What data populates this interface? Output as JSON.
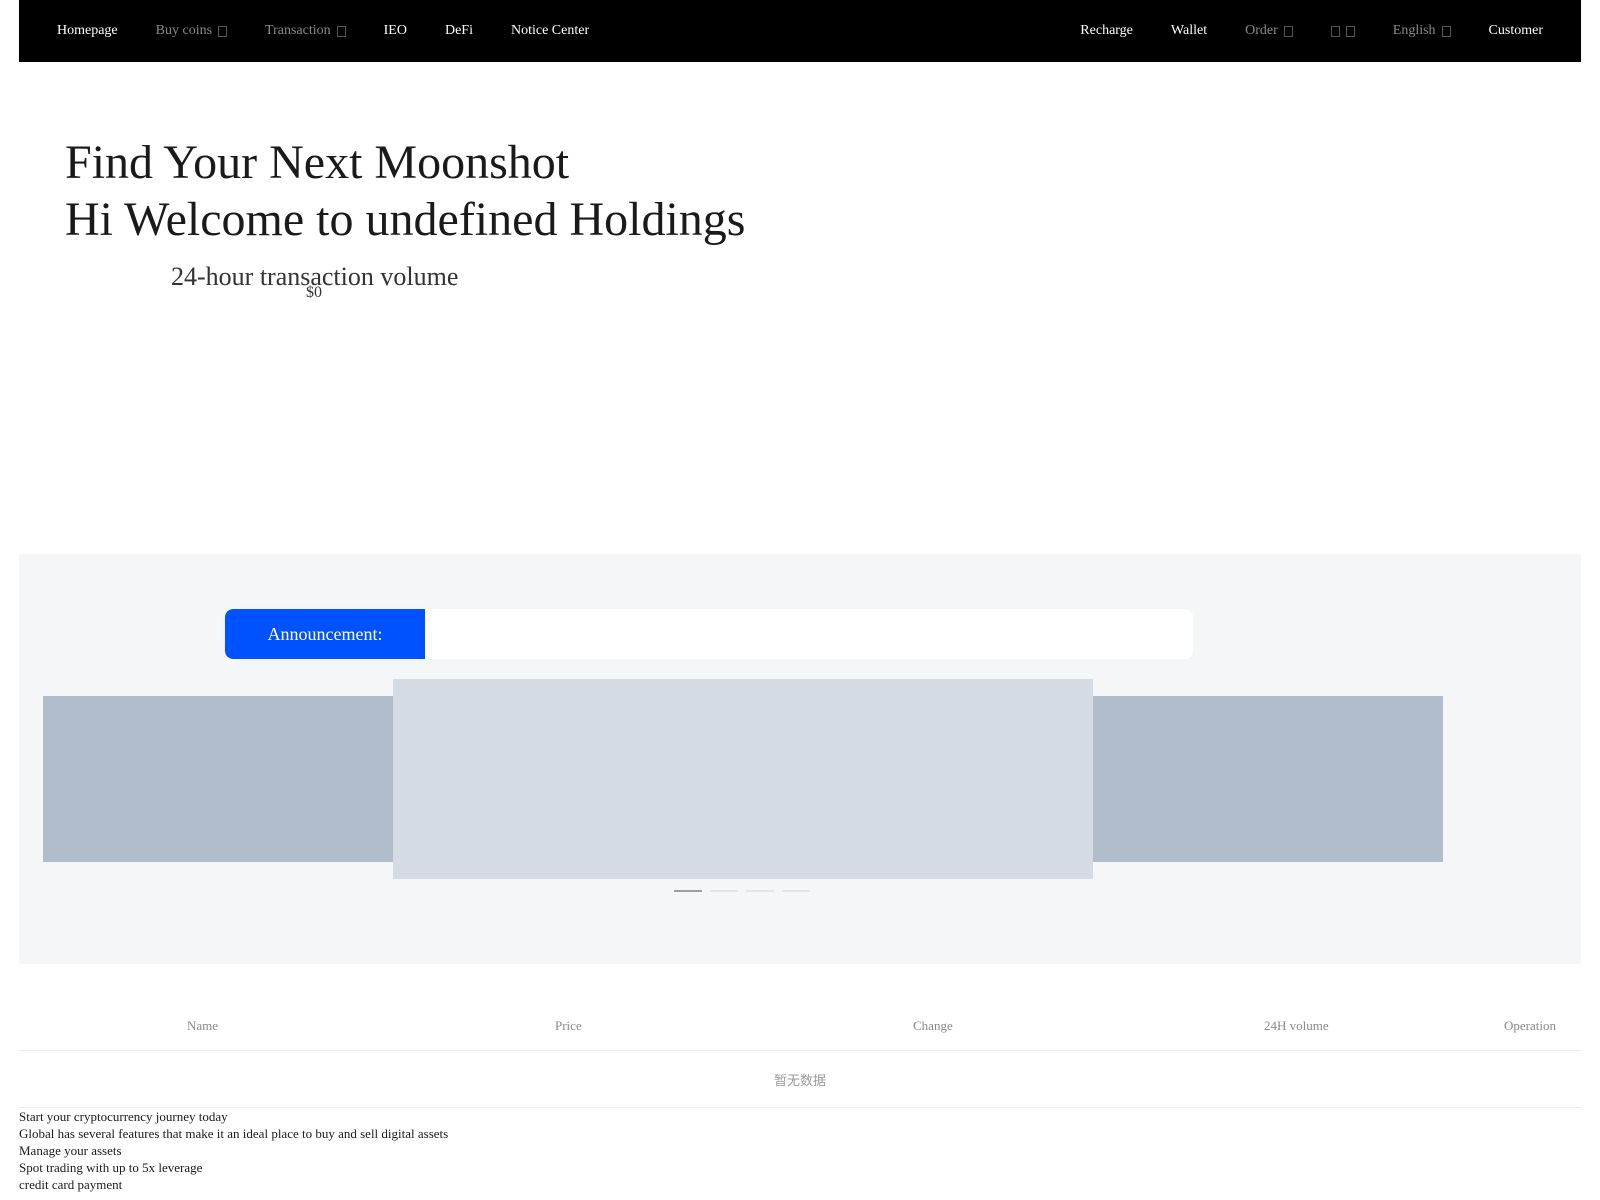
{
  "nav": {
    "left": [
      {
        "label": "Homepage",
        "dim": false,
        "dropdown": false
      },
      {
        "label": "Buy coins",
        "dim": true,
        "dropdown": true
      },
      {
        "label": "Transaction",
        "dim": true,
        "dropdown": true
      },
      {
        "label": "IEO",
        "dim": false,
        "dropdown": false
      },
      {
        "label": "DeFi",
        "dim": false,
        "dropdown": false
      },
      {
        "label": "Notice Center",
        "dim": false,
        "dropdown": false
      }
    ],
    "right": {
      "recharge": "Recharge",
      "wallet": "Wallet",
      "order": "Order",
      "language": "English",
      "customer": "Customer"
    }
  },
  "hero": {
    "line1": "Find Your Next Moonshot",
    "line2": "Hi Welcome to undefined Holdings",
    "volume_label": "24-hour transaction volume",
    "volume_value": "$0"
  },
  "announcement": {
    "label": "Announcement:",
    "text": ""
  },
  "carousel": {
    "slide_count": 4,
    "active_index": 0
  },
  "market_table": {
    "columns": {
      "name": "Name",
      "price": "Price",
      "change": "Change",
      "volume": "24H volume",
      "operation": "Operation"
    },
    "empty_text": "暂无数据"
  },
  "intro": {
    "lines": [
      "Start your cryptocurrency journey today",
      "Global has several features that make it an ideal place to buy and sell digital assets",
      "Manage your assets",
      "Spot trading with up to 5x leverage",
      "credit card payment"
    ]
  },
  "colors": {
    "nav_bg": "#000000",
    "accent_blue": "#0052ff",
    "section_bg": "#f5f6f8",
    "slide_center": "#d4dbe5",
    "slide_side": "#b2bdcc"
  }
}
